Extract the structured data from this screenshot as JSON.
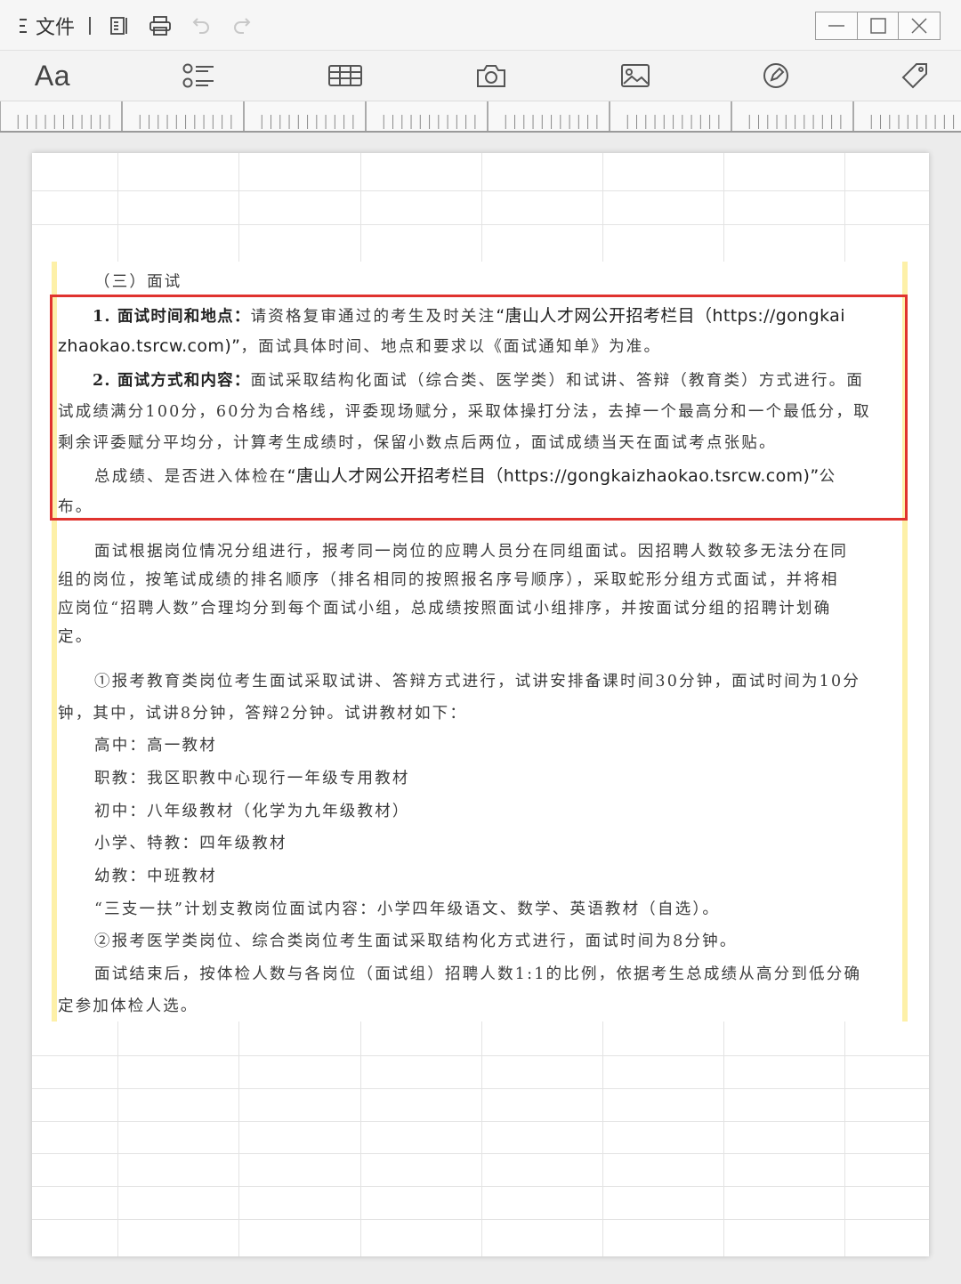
{
  "titlebar": {
    "menu_label": "文件",
    "icons": [
      "menu-icon",
      "outline-icon",
      "print-icon",
      "undo-icon",
      "redo-icon"
    ],
    "window_controls": [
      "minimize-icon",
      "maximize-icon",
      "close-icon"
    ]
  },
  "toolbar": {
    "font_button": "Aa",
    "icons": [
      "list-icon",
      "table-icon",
      "camera-icon",
      "image-icon",
      "pen-icon",
      "tag-icon"
    ]
  },
  "document": {
    "section_heading": "（三）面试",
    "p1_label": "1. 面试时间和地点：",
    "p1_line1": "请资格复审通过的考生及时关注",
    "p1_line1_link": "“唐山人才网公开招考栏目（https://gongkai",
    "p1_line2_link": "zhaokao.tsrcw.com)”",
    "p1_line2_rest": "，面试具体时间、地点和要求以《面试通知单》为准。",
    "p2_label": "2. 面试方式和内容：",
    "p2_line1": "面试采取结构化面试（综合类、医学类）和试讲、答辩（教育类）方式进行。面",
    "p2_line2": "试成绩满分100分，60分为合格线，评委现场赋分，采取体操打分法，去掉一个最高分和一个最低分，取",
    "p2_line3": "剩余评委赋分平均分，计算考生成绩时，保留小数点后两位，面试成绩当天在面试考点张贴。",
    "p3_line1a": "总成绩、是否进入体检在",
    "p3_line1_link": "“唐山人才网公开招考栏目（https://gongkaizhaokao.tsrcw.com)”",
    "p3_line1b": "公",
    "p3_line2": "布。",
    "p4_line1": "面试根据岗位情况分组进行，报考同一岗位的应聘人员分在同组面试。因招聘人数较多无法分在同",
    "p4_line2": "组的岗位，按笔试成绩的排名顺序（排名相同的按照报名序号顺序），采取蛇形分组方式面试，并将相",
    "p4_line3": "应岗位“招聘人数”合理均分到每个面试小组，总成绩按照面试小组排序，并按面试分组的招聘计划确",
    "p4_line4": "定。",
    "p5_line1": "①报考教育类岗位考生面试采取试讲、答辩方式进行，试讲安排备课时间30分钟，面试时间为10分",
    "p5_line2": "钟，其中，试讲8分钟，答辩2分钟。试讲教材如下：",
    "l_high": "高中：高一教材",
    "l_voc": "职教：我区职教中心现行一年级专用教材",
    "l_mid": "初中：八年级教材（化学为九年级教材）",
    "l_pri": "小学、特教：四年级教材",
    "l_kin": "幼教：中班教材",
    "l_sanzhi": "“三支一扶”计划支教岗位面试内容：小学四年级语文、数学、英语教材（自选）。",
    "l_med": "②报考医学类岗位、综合类岗位考生面试采取结构化方式进行，面试时间为8分钟。",
    "p6_line1": "面试结束后，按体检人数与各岗位（面试组）招聘人数1:1的比例，依据考生总成绩从高分到低分确",
    "p6_line2": "定参加体检人选。"
  },
  "colors": {
    "highlight_border": "#e0332e",
    "margin_bar": "#fdf0a8",
    "grid_line": "#e3e3e3"
  }
}
